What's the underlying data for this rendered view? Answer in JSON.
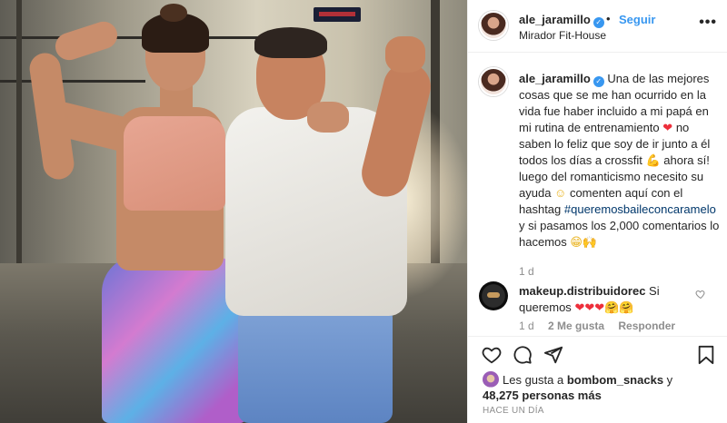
{
  "photo": {
    "alt": "",
    "sign_color": "#d8343a"
  },
  "header": {
    "username": "ale_jaramillo",
    "verified": true,
    "separator": "•",
    "follow_label": "Seguir",
    "location": "Mirador Fit-House",
    "more": "•••"
  },
  "caption": {
    "username": "ale_jaramillo",
    "text_1": "Una de las mejores cosas que se me han ocurrido en la vida fue haber incluido a mi papá en mi rutina de entrenamiento",
    "emoji_heart": "❤",
    "text_2": "no saben lo feliz que soy de ir junto a él todos los días a crossfit",
    "emoji_flex": "💪",
    "text_3": "ahora sí! luego del romanticismo necesito su ayuda",
    "emoji_smile": "☺",
    "text_4": "comenten aquí con el hashtag",
    "hashtag": "#queremosbaileconcaramelo",
    "text_5": "y si pasamos los 2,000 comentarios lo hacemos",
    "emoji_end": "😁🙌",
    "time": "1 d"
  },
  "comment": {
    "username": "makeup.distribuidorec",
    "text": "Si queremos",
    "emojis": "❤❤❤🤗🤗",
    "time": "1 d",
    "likes": "2 Me gusta",
    "reply": "Responder"
  },
  "actions": {
    "like_icon": "heart-icon",
    "comment_icon": "comment-icon",
    "share_icon": "share-icon",
    "save_icon": "bookmark-icon"
  },
  "likes": {
    "prefix": "Les gusta a",
    "first_user": "bombom_snacks",
    "connector": "y",
    "others": "48,275 personas más"
  },
  "posted": "HACE UN DÍA",
  "colors": {
    "link_blue": "#3897f0",
    "hashtag_blue": "#00376b",
    "muted": "#8e8e8e",
    "text": "#262626"
  }
}
